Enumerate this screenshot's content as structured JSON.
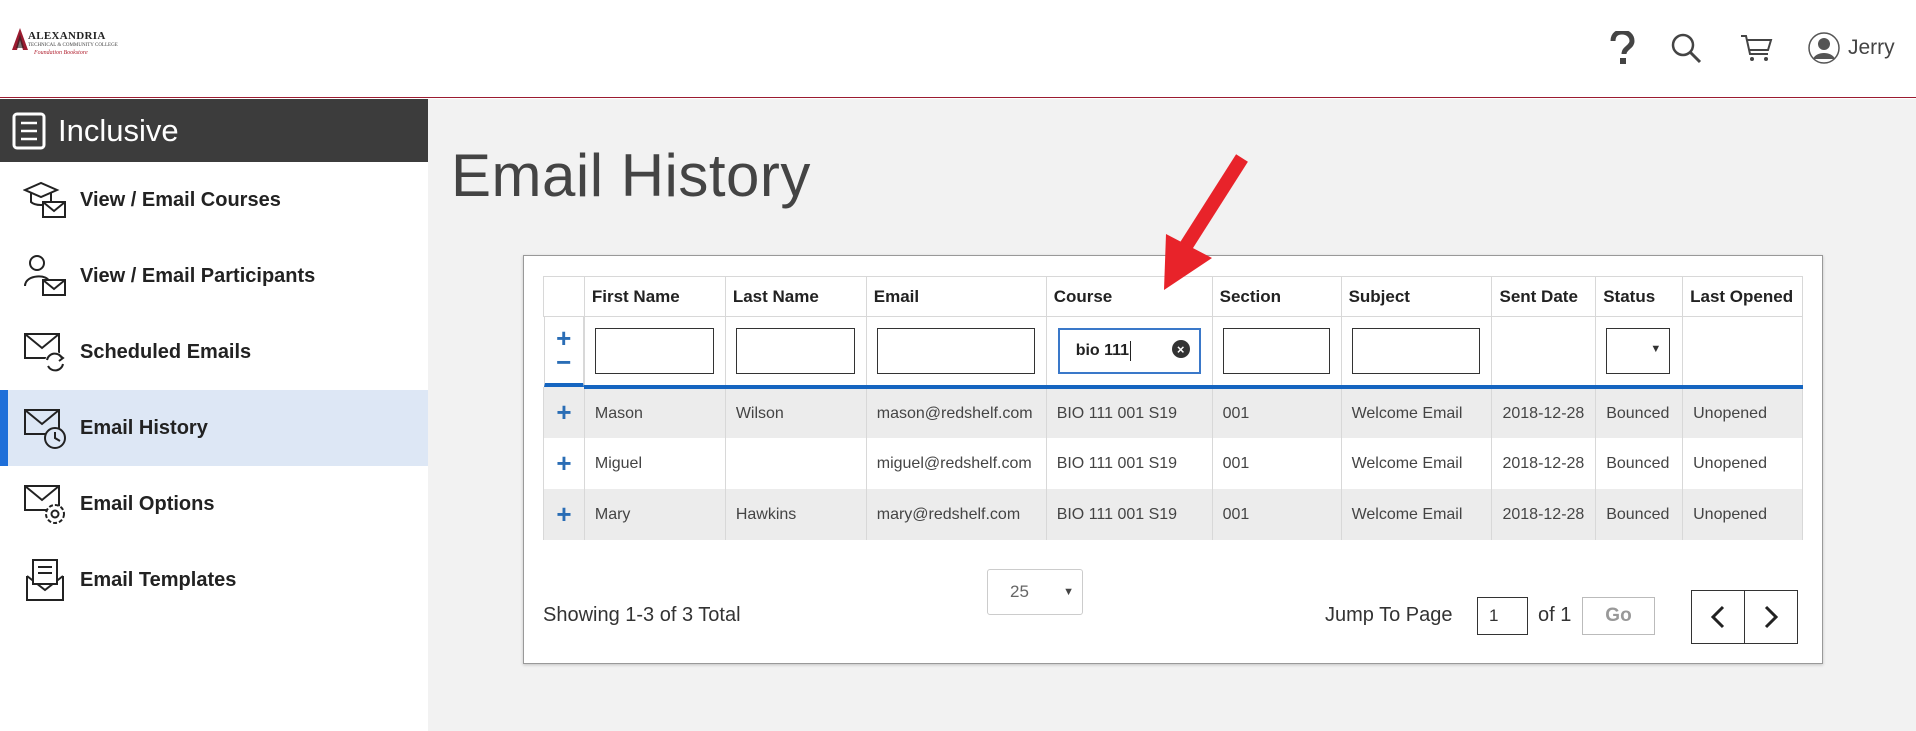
{
  "header": {
    "logo": {
      "name": "ALEXANDRIA",
      "tagline": "TECHNICAL & COMMUNITY COLLEGE",
      "sub": "Foundation Bookstore"
    },
    "icons": [
      "help-icon",
      "search-icon",
      "cart-icon",
      "user-avatar-icon"
    ],
    "user_name": "Jerry"
  },
  "sidebar": {
    "title": "Inclusive",
    "items": [
      {
        "label": "View / Email Courses",
        "icon": "graduation-cap-mail-icon",
        "active": false
      },
      {
        "label": "View / Email Participants",
        "icon": "person-mail-icon",
        "active": false
      },
      {
        "label": "Scheduled Emails",
        "icon": "mail-refresh-icon",
        "active": false
      },
      {
        "label": "Email History",
        "icon": "mail-clock-icon",
        "active": true
      },
      {
        "label": "Email Options",
        "icon": "mail-gear-icon",
        "active": false
      },
      {
        "label": "Email Templates",
        "icon": "mail-document-icon",
        "active": false
      }
    ]
  },
  "main": {
    "title": "Email History",
    "table": {
      "columns": [
        "",
        "First Name",
        "Last Name",
        "Email",
        "Course",
        "Section",
        "Subject",
        "Sent Date",
        "Status",
        "Last Opened"
      ],
      "filters": {
        "first_name": "",
        "last_name": "",
        "email": "",
        "course": "bio 111",
        "section": "",
        "subject": "",
        "status": ""
      },
      "rows": [
        {
          "first": "Mason",
          "last": "Wilson",
          "email": "mason@redshelf.com",
          "course": "BIO 111 001 S19",
          "section": "001",
          "subject": "Welcome Email",
          "sent": "2018-12-28",
          "status": "Bounced",
          "opened": "Unopened"
        },
        {
          "first": "Miguel",
          "last": "",
          "email": "miguel@redshelf.com",
          "course": "BIO 111 001 S19",
          "section": "001",
          "subject": "Welcome Email",
          "sent": "2018-12-28",
          "status": "Bounced",
          "opened": "Unopened"
        },
        {
          "first": "Mary",
          "last": "Hawkins",
          "email": "mary@redshelf.com",
          "course": "BIO 111 001 S19",
          "section": "001",
          "subject": "Welcome Email",
          "sent": "2018-12-28",
          "status": "Bounced",
          "opened": "Unopened"
        }
      ]
    },
    "pagination": {
      "showing": "Showing 1-3 of 3 Total",
      "per_page": "25",
      "jump_label": "Jump To Page",
      "page": "1",
      "of": "of 1",
      "go": "Go"
    },
    "colors": {
      "accent": "#1e6fd9",
      "header_border": "#9b1b30",
      "sidebar_head": "#3c3c3c",
      "active_item_bg": "#dde7f5",
      "link": "#2c6cb5",
      "annotation_arrow": "#e8232a"
    }
  }
}
